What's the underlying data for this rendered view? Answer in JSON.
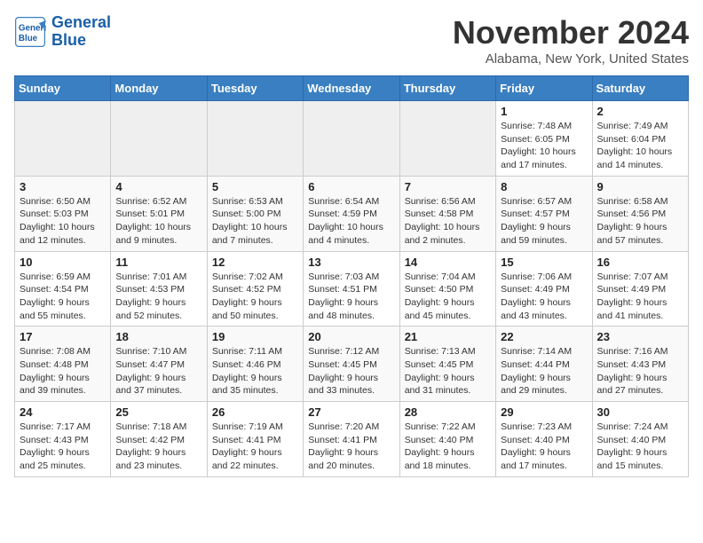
{
  "header": {
    "logo_line1": "General",
    "logo_line2": "Blue",
    "month": "November 2024",
    "location": "Alabama, New York, United States"
  },
  "weekdays": [
    "Sunday",
    "Monday",
    "Tuesday",
    "Wednesday",
    "Thursday",
    "Friday",
    "Saturday"
  ],
  "weeks": [
    [
      {
        "day": "",
        "info": ""
      },
      {
        "day": "",
        "info": ""
      },
      {
        "day": "",
        "info": ""
      },
      {
        "day": "",
        "info": ""
      },
      {
        "day": "",
        "info": ""
      },
      {
        "day": "1",
        "info": "Sunrise: 7:48 AM\nSunset: 6:05 PM\nDaylight: 10 hours and 17 minutes."
      },
      {
        "day": "2",
        "info": "Sunrise: 7:49 AM\nSunset: 6:04 PM\nDaylight: 10 hours and 14 minutes."
      }
    ],
    [
      {
        "day": "3",
        "info": "Sunrise: 6:50 AM\nSunset: 5:03 PM\nDaylight: 10 hours and 12 minutes."
      },
      {
        "day": "4",
        "info": "Sunrise: 6:52 AM\nSunset: 5:01 PM\nDaylight: 10 hours and 9 minutes."
      },
      {
        "day": "5",
        "info": "Sunrise: 6:53 AM\nSunset: 5:00 PM\nDaylight: 10 hours and 7 minutes."
      },
      {
        "day": "6",
        "info": "Sunrise: 6:54 AM\nSunset: 4:59 PM\nDaylight: 10 hours and 4 minutes."
      },
      {
        "day": "7",
        "info": "Sunrise: 6:56 AM\nSunset: 4:58 PM\nDaylight: 10 hours and 2 minutes."
      },
      {
        "day": "8",
        "info": "Sunrise: 6:57 AM\nSunset: 4:57 PM\nDaylight: 9 hours and 59 minutes."
      },
      {
        "day": "9",
        "info": "Sunrise: 6:58 AM\nSunset: 4:56 PM\nDaylight: 9 hours and 57 minutes."
      }
    ],
    [
      {
        "day": "10",
        "info": "Sunrise: 6:59 AM\nSunset: 4:54 PM\nDaylight: 9 hours and 55 minutes."
      },
      {
        "day": "11",
        "info": "Sunrise: 7:01 AM\nSunset: 4:53 PM\nDaylight: 9 hours and 52 minutes."
      },
      {
        "day": "12",
        "info": "Sunrise: 7:02 AM\nSunset: 4:52 PM\nDaylight: 9 hours and 50 minutes."
      },
      {
        "day": "13",
        "info": "Sunrise: 7:03 AM\nSunset: 4:51 PM\nDaylight: 9 hours and 48 minutes."
      },
      {
        "day": "14",
        "info": "Sunrise: 7:04 AM\nSunset: 4:50 PM\nDaylight: 9 hours and 45 minutes."
      },
      {
        "day": "15",
        "info": "Sunrise: 7:06 AM\nSunset: 4:49 PM\nDaylight: 9 hours and 43 minutes."
      },
      {
        "day": "16",
        "info": "Sunrise: 7:07 AM\nSunset: 4:49 PM\nDaylight: 9 hours and 41 minutes."
      }
    ],
    [
      {
        "day": "17",
        "info": "Sunrise: 7:08 AM\nSunset: 4:48 PM\nDaylight: 9 hours and 39 minutes."
      },
      {
        "day": "18",
        "info": "Sunrise: 7:10 AM\nSunset: 4:47 PM\nDaylight: 9 hours and 37 minutes."
      },
      {
        "day": "19",
        "info": "Sunrise: 7:11 AM\nSunset: 4:46 PM\nDaylight: 9 hours and 35 minutes."
      },
      {
        "day": "20",
        "info": "Sunrise: 7:12 AM\nSunset: 4:45 PM\nDaylight: 9 hours and 33 minutes."
      },
      {
        "day": "21",
        "info": "Sunrise: 7:13 AM\nSunset: 4:45 PM\nDaylight: 9 hours and 31 minutes."
      },
      {
        "day": "22",
        "info": "Sunrise: 7:14 AM\nSunset: 4:44 PM\nDaylight: 9 hours and 29 minutes."
      },
      {
        "day": "23",
        "info": "Sunrise: 7:16 AM\nSunset: 4:43 PM\nDaylight: 9 hours and 27 minutes."
      }
    ],
    [
      {
        "day": "24",
        "info": "Sunrise: 7:17 AM\nSunset: 4:43 PM\nDaylight: 9 hours and 25 minutes."
      },
      {
        "day": "25",
        "info": "Sunrise: 7:18 AM\nSunset: 4:42 PM\nDaylight: 9 hours and 23 minutes."
      },
      {
        "day": "26",
        "info": "Sunrise: 7:19 AM\nSunset: 4:41 PM\nDaylight: 9 hours and 22 minutes."
      },
      {
        "day": "27",
        "info": "Sunrise: 7:20 AM\nSunset: 4:41 PM\nDaylight: 9 hours and 20 minutes."
      },
      {
        "day": "28",
        "info": "Sunrise: 7:22 AM\nSunset: 4:40 PM\nDaylight: 9 hours and 18 minutes."
      },
      {
        "day": "29",
        "info": "Sunrise: 7:23 AM\nSunset: 4:40 PM\nDaylight: 9 hours and 17 minutes."
      },
      {
        "day": "30",
        "info": "Sunrise: 7:24 AM\nSunset: 4:40 PM\nDaylight: 9 hours and 15 minutes."
      }
    ]
  ]
}
